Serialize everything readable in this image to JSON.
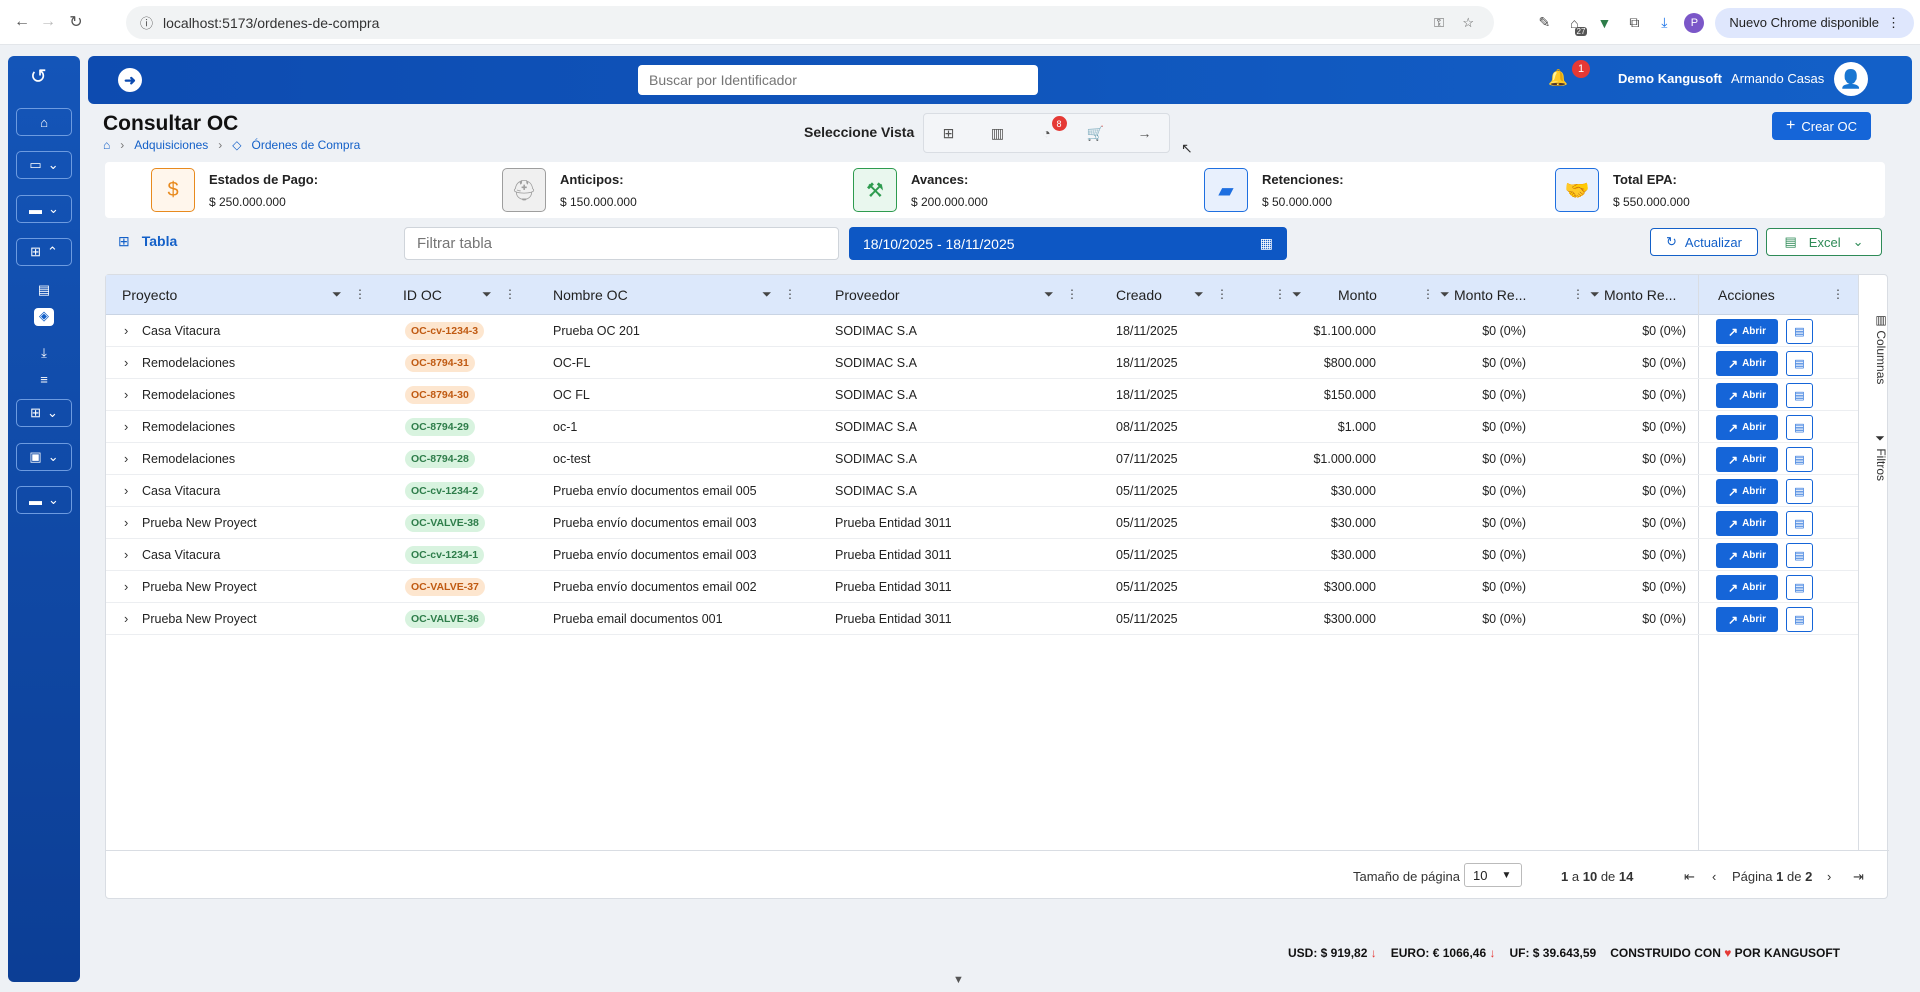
{
  "browser": {
    "url": "localhost:5173/ordenes-de-compra",
    "new_chrome_label": "Nuevo Chrome disponible",
    "profile_initial": "P",
    "ext_badge": "27"
  },
  "header": {
    "search_placeholder": "Buscar por Identificador",
    "notification_count": "1",
    "company": "Demo Kangusoft",
    "user": "Armando Casas"
  },
  "page": {
    "title": "Consultar OC",
    "breadcrumbs": [
      "Adquisiciones",
      "Órdenes de Compra"
    ],
    "view_label": "Seleccione Vista",
    "view_badge": "8",
    "create_button": "Crear OC"
  },
  "stats": [
    {
      "label": "Estados de Pago:",
      "value": "$ 250.000.000",
      "color": "#e88a1e"
    },
    {
      "label": "Anticipos:",
      "value": "$ 150.000.000",
      "color": "#9e9e9e"
    },
    {
      "label": "Avances:",
      "value": "$ 200.000.000",
      "color": "#2e9b4f"
    },
    {
      "label": "Retenciones:",
      "value": "$ 50.000.000",
      "color": "#1e6fe0"
    },
    {
      "label": "Total EPA:",
      "value": "$ 550.000.000",
      "color": "#1e6fe0"
    }
  ],
  "toolbar": {
    "tab_label": "Tabla",
    "filter_placeholder": "Filtrar tabla",
    "date_range": "18/10/2025 - 18/11/2025",
    "refresh_label": "Actualizar",
    "excel_label": "Excel"
  },
  "table": {
    "columns": [
      "Proyecto",
      "ID OC",
      "Nombre OC",
      "Proveedor",
      "Creado",
      "Monto",
      "Monto Re...",
      "Monto Re...",
      "Acciones"
    ],
    "open_label": "Abrir",
    "rows": [
      {
        "proyecto": "Casa Vitacura",
        "id": "OC-cv-1234-3",
        "status": "orange",
        "nombre": "Prueba OC 201",
        "proveedor": "SODIMAC S.A",
        "creado": "18/11/2025",
        "monto": "$1.100.000",
        "re1": "$0 (0%)",
        "re2": "$0 (0%)"
      },
      {
        "proyecto": "Remodelaciones",
        "id": "OC-8794-31",
        "status": "orange",
        "nombre": "OC-FL",
        "proveedor": "SODIMAC S.A",
        "creado": "18/11/2025",
        "monto": "$800.000",
        "re1": "$0 (0%)",
        "re2": "$0 (0%)"
      },
      {
        "proyecto": "Remodelaciones",
        "id": "OC-8794-30",
        "status": "orange",
        "nombre": "OC FL",
        "proveedor": "SODIMAC S.A",
        "creado": "18/11/2025",
        "monto": "$150.000",
        "re1": "$0 (0%)",
        "re2": "$0 (0%)"
      },
      {
        "proyecto": "Remodelaciones",
        "id": "OC-8794-29",
        "status": "green",
        "nombre": "oc-1",
        "proveedor": "SODIMAC S.A",
        "creado": "08/11/2025",
        "monto": "$1.000",
        "re1": "$0 (0%)",
        "re2": "$0 (0%)"
      },
      {
        "proyecto": "Remodelaciones",
        "id": "OC-8794-28",
        "status": "green",
        "nombre": "oc-test",
        "proveedor": "SODIMAC S.A",
        "creado": "07/11/2025",
        "monto": "$1.000.000",
        "re1": "$0 (0%)",
        "re2": "$0 (0%)"
      },
      {
        "proyecto": "Casa Vitacura",
        "id": "OC-cv-1234-2",
        "status": "green",
        "nombre": "Prueba envío documentos email 005",
        "proveedor": "SODIMAC S.A",
        "creado": "05/11/2025",
        "monto": "$30.000",
        "re1": "$0 (0%)",
        "re2": "$0 (0%)"
      },
      {
        "proyecto": "Prueba New Proyect",
        "id": "OC-VALVE-38",
        "status": "green",
        "nombre": "Prueba envío documentos email 003",
        "proveedor": "Prueba Entidad 3011",
        "creado": "05/11/2025",
        "monto": "$30.000",
        "re1": "$0 (0%)",
        "re2": "$0 (0%)"
      },
      {
        "proyecto": "Casa Vitacura",
        "id": "OC-cv-1234-1",
        "status": "green",
        "nombre": "Prueba envío documentos email 003",
        "proveedor": "Prueba Entidad 3011",
        "creado": "05/11/2025",
        "monto": "$30.000",
        "re1": "$0 (0%)",
        "re2": "$0 (0%)"
      },
      {
        "proyecto": "Prueba New Proyect",
        "id": "OC-VALVE-37",
        "status": "orange",
        "nombre": "Prueba envío documentos email 002",
        "proveedor": "Prueba Entidad 3011",
        "creado": "05/11/2025",
        "monto": "$300.000",
        "re1": "$0 (0%)",
        "re2": "$0 (0%)"
      },
      {
        "proyecto": "Prueba New Proyect",
        "id": "OC-VALVE-36",
        "status": "green",
        "nombre": "Prueba email documentos 001",
        "proveedor": "Prueba Entidad 3011",
        "creado": "05/11/2025",
        "monto": "$300.000",
        "re1": "$0 (0%)",
        "re2": "$0 (0%)"
      }
    ]
  },
  "side_panel": {
    "columns": "Columnas",
    "filters": "Filtros"
  },
  "pagination": {
    "page_size_label": "Tamaño de página",
    "page_size": "10",
    "from": "1",
    "to": "10",
    "total": "14",
    "a_word": "a",
    "de_word": "de",
    "page_word": "Página",
    "current_page": "1",
    "total_pages": "2"
  },
  "footer": {
    "usd": "USD: $ 919,82",
    "euro": "EURO: € 1066,46",
    "uf": "UF: $ 39.643,59",
    "built_prefix": "CONSTRUIDO CON",
    "built_suffix": "POR KANGUSOFT"
  }
}
